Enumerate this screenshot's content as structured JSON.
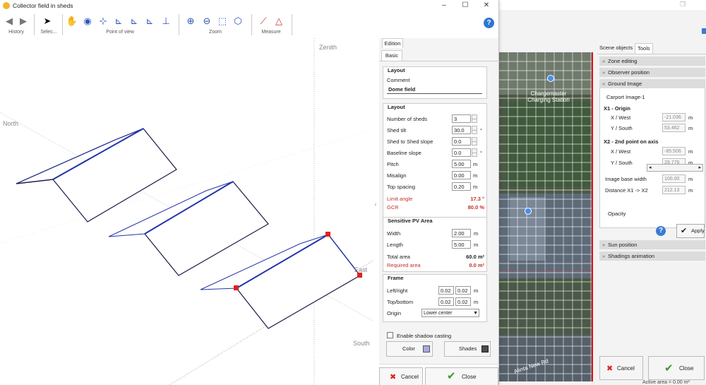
{
  "main_window": {
    "title": "Collector field in sheds",
    "controls": [
      "–",
      "☐",
      "✕"
    ]
  },
  "toolbar": {
    "groups": [
      {
        "label": "History"
      },
      {
        "label": "Selec..."
      },
      {
        "label": "Point of view"
      },
      {
        "label": "Zoom"
      },
      {
        "label": "Measure"
      }
    ],
    "icons": {
      "back": "arrow-left-icon",
      "forward": "arrow-right-icon",
      "select": "cursor-icon",
      "pan": "hand-icon",
      "orbit": "eye-icon"
    },
    "accent_color": "#2a55b8"
  },
  "viewport": {
    "axis_labels": {
      "zenith": "Zenith",
      "north": "North",
      "south": "South",
      "east": "East"
    }
  },
  "form": {
    "tab_top": "Edition",
    "tab_sub": "Basic",
    "layout_comment": {
      "title": "Layout",
      "comment_label": "Comment",
      "comment_value": "Dome field"
    },
    "layout": {
      "title": "Layout",
      "rows": [
        {
          "label": "Number of sheds",
          "value": "3",
          "unit": ""
        },
        {
          "label": "Shed tilt",
          "value": "30.0",
          "unit": "°"
        },
        {
          "label": "Shed to Shed slope",
          "value": "0.0",
          "unit": ""
        },
        {
          "label": "Baseline slope",
          "value": "0.0",
          "unit": "°"
        },
        {
          "label": "Pitch",
          "value": "5.00",
          "unit": "m"
        },
        {
          "label": "Misalign",
          "value": "0.00",
          "unit": "m"
        },
        {
          "label": "Top spacing",
          "value": "0.20",
          "unit": "m"
        }
      ],
      "limit_angle_label": "Limit angle",
      "limit_angle_value": "17.3 °",
      "gcr_label": "GCR",
      "gcr_value": "80.0 %"
    },
    "sensitive": {
      "title": "Sensitive PV Area",
      "width_label": "Width",
      "width_value": "2.00",
      "length_label": "Length",
      "length_value": "5.00",
      "unit": "m",
      "total_label": "Total area",
      "total_value": "60.0 m²",
      "required_label": "Required area",
      "required_value": "0.0 m²"
    },
    "frame": {
      "title": "Frame",
      "lr_label": "Left/right",
      "lr_a": "0.02",
      "lr_b": "0.02",
      "tb_label": "Top/bottom",
      "tb_a": "0.02",
      "tb_b": "0.02",
      "unit": "m",
      "origin_label": "Origin",
      "origin_value": "Lower center"
    },
    "shadow_label": "Enable shadow casting",
    "color_label": "Color",
    "color_swatch": "#a9a9dc",
    "shades_label": "Shades",
    "shades_swatch": "#4a4a4a",
    "cancel_label": "Cancel",
    "close_label": "Close"
  },
  "bg_window": {
    "scene_tab": "Scene objects",
    "tools_tab": "Tools",
    "sections": [
      "Zone editing",
      "Observer position",
      "Ground Image"
    ],
    "image_name": "Carport Image-1",
    "x1_title": "X1 - Origin",
    "x1_x_label": "X / West",
    "x1_x_value": "-21.036",
    "x1_y_label": "Y / South",
    "x1_y_value": "53.462",
    "x2_title": "X2 - 2nd point on axis",
    "x2_x_label": "X / West",
    "x2_x_value": "-85.506",
    "x2_y_label": "Y / South",
    "x2_y_value": "29.776",
    "unit": "m",
    "base_width_label": "Image base width",
    "base_width_value": "100.00",
    "distance_label": "Distance X1 -> X2",
    "distance_value": "212.13",
    "opacity_label": "Opacity",
    "apply_label": "Apply",
    "sun_label": "Sun position",
    "shading_label": "Shadings animation",
    "cancel_label": "Cancel",
    "close_label": "Close",
    "status_text": "Active area = 0.00 m²",
    "map_labels": {
      "charge": "Chargemaster\nCharging Station",
      "road": "Alinta New Rd"
    }
  }
}
